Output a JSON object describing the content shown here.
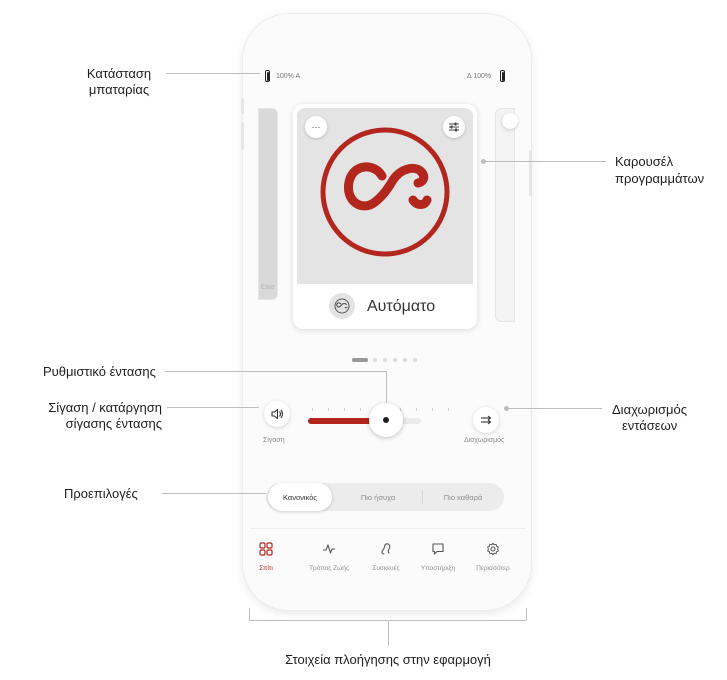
{
  "status_bar": {
    "left_battery": "100% A",
    "right_battery": "Δ 100%"
  },
  "carousel": {
    "current_program_label": "Αυτόματο",
    "menu_glyph": "···",
    "settings_icon": "sliders-icon",
    "logo_icon": "auto-program-logo",
    "side_card_text": "Επισ",
    "page_count": 6,
    "active_page": 1
  },
  "volume": {
    "mute_label": "Σίγαση",
    "split_label": "Διαχωρισμός",
    "level_percent": 53,
    "mute_icon": "speaker-icon",
    "split_icon": "split-arrows-icon"
  },
  "presets": {
    "items": [
      "Κανονικός",
      "Πιο ήσυχα",
      "Πιο καθαρά"
    ],
    "selected": "Κανονικός"
  },
  "nav": {
    "items": [
      {
        "label": "Σπίτι",
        "icon": "grid-icon",
        "active": true
      },
      {
        "label": "Τρόπος Ζωής",
        "icon": "pulse-icon",
        "active": false
      },
      {
        "label": "Συσκευές",
        "icon": "hearing-aid-icon",
        "active": false
      },
      {
        "label": "Υποστήριξη",
        "icon": "chat-icon",
        "active": false
      },
      {
        "label": "Περισσότερ",
        "icon": "gear-icon",
        "active": false
      }
    ]
  },
  "annotations": {
    "battery_line1": "Κατάσταση",
    "battery_line2": "μπαταρίας",
    "carousel_line1": "Καρουσέλ",
    "carousel_line2": "προγραμμάτων",
    "volume_slider": "Ρυθμιστικό έντασης",
    "mute_line1": "Σίγαση / κατάργηση",
    "mute_line2": "σίγασης έντασης",
    "split_line1": "Διαχωρισμός",
    "split_line2": "εντάσεων",
    "presets": "Προεπιλογές",
    "navigation": "Στοιχεία πλοήγησης στην εφαρμογή"
  },
  "colors": {
    "accent": "#b3261e",
    "card_image_bg": "#e4e4e4",
    "annotation_line": "#bdbdbd"
  }
}
